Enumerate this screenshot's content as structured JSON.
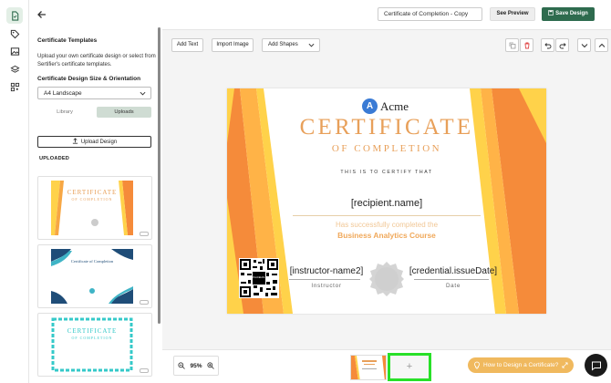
{
  "rail": {
    "icons": [
      "certificate-file-icon",
      "tag-icon",
      "image-icon",
      "layers-icon",
      "qr-code-icon"
    ]
  },
  "panel": {
    "heading": "Certificate Templates",
    "description": "Upload your own certificate design or select from Sertifier's certificate templates.",
    "size_heading": "Certificate Design Size & Orientation",
    "size_value": "A4 Landscape",
    "tab_library": "Library",
    "tab_uploads": "Uploads",
    "upload_button": "Upload Design",
    "uploaded_heading": "UPLOADED",
    "thumb1": {
      "title": "CERTIFICATE",
      "sub": "OF COMPLETION"
    },
    "thumb2": {
      "title": "Certificate of Completion"
    },
    "thumb3": {
      "title": "CERTIFICATE",
      "sub": "OF COMPLETION"
    }
  },
  "header": {
    "design_name": "Certificate of Completion - Copy",
    "preview_label": "See Preview",
    "save_label": "Save Design"
  },
  "toolbar": {
    "add_text": "Add Text",
    "import_image": "Import Image",
    "add_shapes": "Add Shapes"
  },
  "certificate": {
    "logo_letter": "A",
    "logo_text": "Acme",
    "title": "CERTIFICATE",
    "subtitle": "OF COMPLETION",
    "certify": "THIS IS TO CERTIFY THAT",
    "recipient": "[recipient.name]",
    "completed": "Has successfully completed the",
    "course": "Business Analytics Course",
    "instructor": "[instructor-name2]",
    "instructor_label": "Instructor",
    "date": "[credential.issueDate]",
    "date_label": "Date",
    "qr_placeholder": "PLACEHOLDER",
    "colors": {
      "orange": "#f58b3a",
      "yellow": "#ffd24a",
      "title": "#e8a05a"
    }
  },
  "footer": {
    "zoom": "95%",
    "add_page": "+",
    "help_label": "How to Design a Certificate?"
  },
  "colors": {
    "accent": "#2e6b4e",
    "highlight": "#28e028",
    "help": "#f0b95e"
  }
}
